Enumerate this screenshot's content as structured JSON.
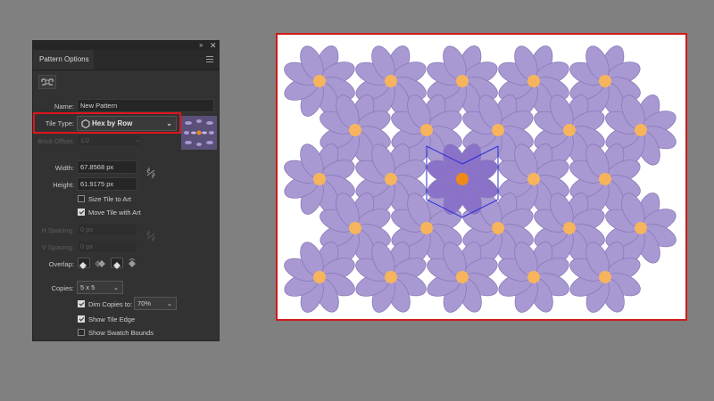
{
  "panel": {
    "title": "Pattern Options",
    "name_label": "Name:",
    "name_value": "New Pattern",
    "tile_type_label": "Tile Type:",
    "tile_type_value": "Hex by Row",
    "brick_offset_label": "Brick Offset:",
    "brick_offset_value": "1/2",
    "width_label": "Width:",
    "width_value": "67.8568 px",
    "height_label": "Height:",
    "height_value": "61.9175 px",
    "size_tile_label": "Size Tile to Art",
    "size_tile_checked": false,
    "move_tile_label": "Move Tile with Art",
    "move_tile_checked": true,
    "h_spacing_label": "H Spacing:",
    "h_spacing_value": "0 px",
    "v_spacing_label": "V Spacing:",
    "v_spacing_value": "0 px",
    "overlap_label": "Overlap:",
    "copies_label": "Copies:",
    "copies_value": "5 x 5",
    "dim_copies_label": "Dim Copies to:",
    "dim_copies_checked": true,
    "dim_copies_value": "70%",
    "show_tile_edge_label": "Show Tile Edge",
    "show_tile_edge_checked": true,
    "show_swatch_bounds_label": "Show Swatch Bounds",
    "show_swatch_bounds_checked": false
  },
  "icons": {
    "collapse": "double-arrow-icon",
    "close": "close-icon",
    "menu": "panel-menu-icon",
    "edit_tile": "pattern-tile-tool-icon",
    "tile_type": "hexagon-icon",
    "link": "link-chain-icon"
  },
  "colors": {
    "petal": "#a899d3",
    "petal_stroke": "#8a7ab8",
    "center": "#f6b45c",
    "tile_edge": "#2a2ad8",
    "highlight": "#e0141e"
  }
}
